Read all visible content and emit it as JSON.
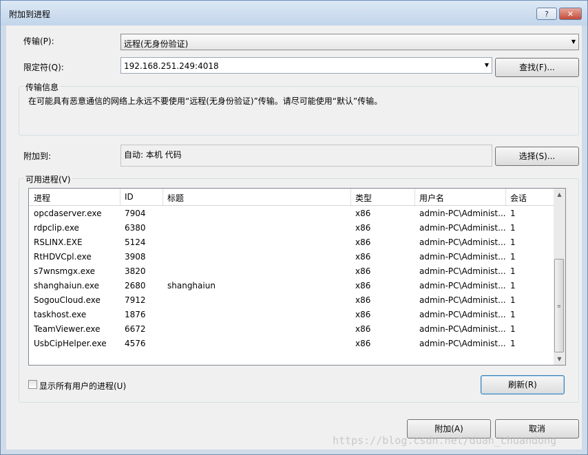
{
  "window": {
    "title": "附加到进程",
    "help_label": "?",
    "close_label": "✕"
  },
  "transport": {
    "label": "传输(P):",
    "value": "远程(无身份验证)"
  },
  "qualifier": {
    "label": "限定符(Q):",
    "value": "192.168.251.249:4018",
    "find_label": "查找(F)..."
  },
  "transport_info": {
    "title": "传输信息",
    "text": "在可能具有恶意通信的网络上永远不要使用“远程(无身份验证)”传输。请尽可能使用“默认”传输。"
  },
  "attach_to": {
    "label": "附加到:",
    "value": "自动: 本机 代码",
    "select_label": "选择(S)..."
  },
  "processes": {
    "group_title": "可用进程(V)",
    "columns": [
      "进程",
      "ID",
      "标题",
      "类型",
      "用户名",
      "会话"
    ],
    "rows": [
      [
        "opcdaserver.exe",
        "7904",
        "",
        "x86",
        "admin-PC\\Administ...",
        "1"
      ],
      [
        "rdpclip.exe",
        "6380",
        "",
        "x86",
        "admin-PC\\Administ...",
        "1"
      ],
      [
        "RSLINX.EXE",
        "5124",
        "",
        "x86",
        "admin-PC\\Administ...",
        "1"
      ],
      [
        "RtHDVCpl.exe",
        "3908",
        "",
        "x86",
        "admin-PC\\Administ...",
        "1"
      ],
      [
        "s7wnsmgx.exe",
        "3820",
        "",
        "x86",
        "admin-PC\\Administ...",
        "1"
      ],
      [
        "shanghaiun.exe",
        "2680",
        "shanghaiun",
        "x86",
        "admin-PC\\Administ...",
        "1"
      ],
      [
        "SogouCloud.exe",
        "7912",
        "",
        "x86",
        "admin-PC\\Administ...",
        "1"
      ],
      [
        "taskhost.exe",
        "1876",
        "",
        "x86",
        "admin-PC\\Administ...",
        "1"
      ],
      [
        "TeamViewer.exe",
        "6672",
        "",
        "x86",
        "admin-PC\\Administ...",
        "1"
      ],
      [
        "UsbCipHelper.exe",
        "4576",
        "",
        "x86",
        "admin-PC\\Administ...",
        "1"
      ]
    ],
    "show_all_users_label": "显示所有用户的进程(U)",
    "show_all_users_checked": false,
    "refresh_label": "刷新(R)"
  },
  "footer": {
    "attach_label": "附加(A)",
    "cancel_label": "取消",
    "watermark": "https://blog.csdn.net/duan_chuandong"
  }
}
